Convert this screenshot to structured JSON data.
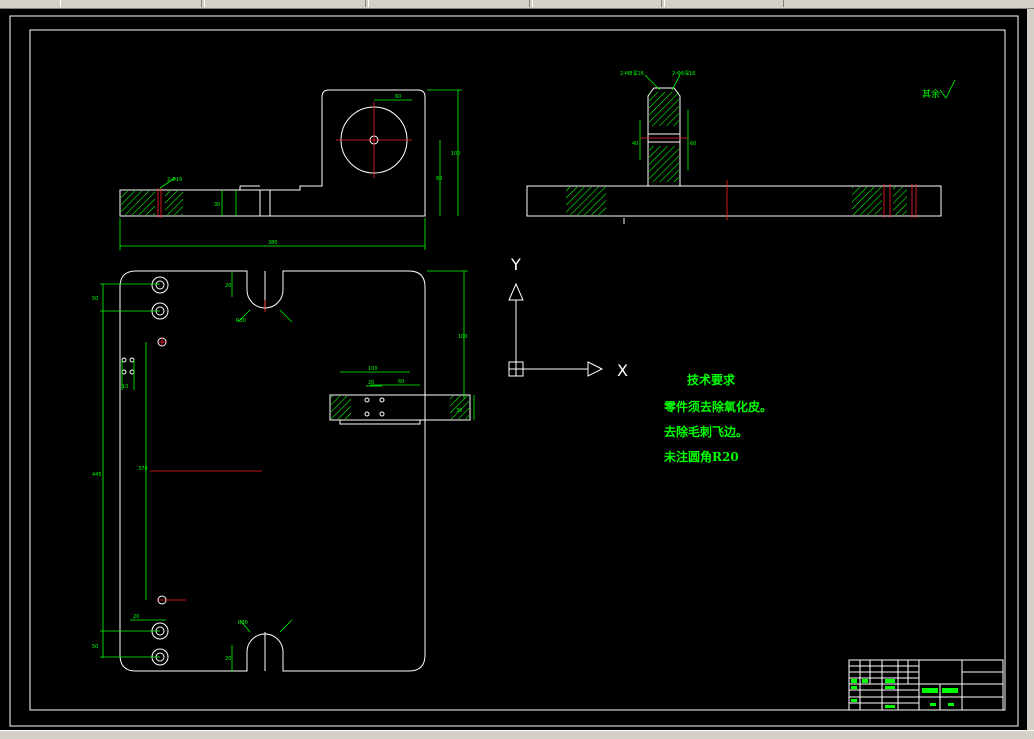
{
  "colors": {
    "background": "#000000",
    "outline": "#ffffff",
    "dimension": "#00ff00",
    "centerline": "#ff2020"
  },
  "roughness_symbol": "其余",
  "ucs": {
    "x_label": "X",
    "y_label": "Y"
  },
  "technical_requirements": {
    "title": "技术要求",
    "lines": [
      "零件须去除氧化皮。",
      "去除毛刺飞边。",
      "未注圆角R20"
    ]
  },
  "dimensions": {
    "front_overall_length": "380",
    "front_overall_height": "100",
    "circle_size": "60",
    "front_height_2": "80",
    "front_thickness": "30",
    "front_hole": "2-Φ16",
    "plan_height": "445",
    "plan_hole_span": "370",
    "plan_slot_width": "20",
    "plan_hole_pitch": "50",
    "plan_side_width": "10",
    "plan_tab_width": "100",
    "plan_tab_depth": "60",
    "plan_tab_hole": "20",
    "plan_tab_height": "30",
    "plan_slot_r_top": "R30",
    "plan_slot_r_bottom": "R30",
    "side_height": "40",
    "side_height_2": "60",
    "side_hole_left": "2-M8深16",
    "side_hole_right": "2-Φ8深16"
  },
  "title_block": {
    "label": ""
  }
}
